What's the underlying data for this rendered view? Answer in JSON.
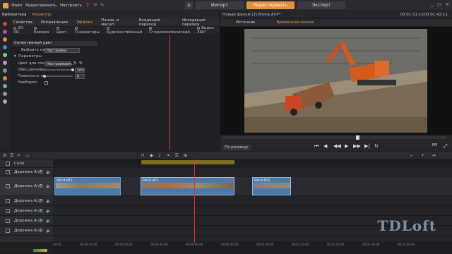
{
  "menu": [
    "Файл",
    "Редактировать",
    "Настроить",
    "❓",
    "↶",
    "↷"
  ],
  "mode_tabs": {
    "import": "Импорт",
    "edit": "Редактировать",
    "export": "Экспорт"
  },
  "window_controls": [
    "_",
    "□",
    "✕"
  ],
  "library": {
    "tab1": "Библиотека",
    "tab2": "Редактор"
  },
  "categories": [
    "Свойства",
    "Исправления",
    "Эффект",
    "Панор. и масшт.",
    "Входящий переход",
    "Исходящий переход"
  ],
  "active_category": "Эффект",
  "subcategories": [
    "2D-3D",
    "Камера",
    "Цвет",
    "Генераторы",
    "Художественный",
    "Стереоскопический",
    "Видео 360°"
  ],
  "effect": {
    "title": "Селективный цвет",
    "choose_label": "Выбрать нас...",
    "choose_value": "Настройка",
    "params_label": "Параметры",
    "color_label": "Цвет для сохр...",
    "color_value": "Настраиваем...",
    "desat_label": "Обесцвечиван...",
    "desat_value": "100",
    "smooth_label": "Плавность пе...",
    "smooth_value": "0",
    "invert_label": "Наоборот",
    "invert_checked": false
  },
  "player": {
    "title": "Новый фильм (2).Movie.AXP*",
    "timecode": "00:01:11:15",
    "timecode2": "00:01:42:11",
    "tab_source": "Источник",
    "tab_timeline": "Временная шкала",
    "fit_label": "По размеру окна",
    "pip": "PiP"
  },
  "timeline": {
    "tracks": [
      {
        "name": "Соло",
        "icon": "solo",
        "type": "solo"
      },
      {
        "name": "Дорожка A/...",
        "icon": "track",
        "type": "av"
      },
      {
        "name": "Дорожка A/...",
        "icon": "track",
        "type": "av"
      },
      {
        "name": "Дорожка A/...",
        "icon": "track",
        "type": "av"
      },
      {
        "name": "Дорожка A/...",
        "icon": "track",
        "type": "av"
      },
      {
        "name": "Дорожка A/...",
        "icon": "track",
        "type": "av"
      },
      {
        "name": "Дорожка A/...",
        "icon": "track",
        "type": "av"
      }
    ],
    "clips": [
      {
        "label": "00074.MTS"
      },
      {
        "label": "00074.MTS"
      },
      {
        "label": "00074.MTS"
      }
    ],
    "ruler_ticks": [
      "00:00",
      "00:00:10:00",
      "00:00:20:00",
      "00:00:30:00",
      "00:00:40:00",
      "00:00:50:00",
      "00:01:00:00",
      "00:01:10:00",
      "00:01:20:00",
      "00:01:30:00",
      "00:01:40:00"
    ]
  },
  "watermark": "TDLoft",
  "colors": {
    "accent": "#e8913a",
    "clip": "#4c7aa8",
    "playhead": "#dd3333",
    "selection": "#7a6f1f"
  }
}
